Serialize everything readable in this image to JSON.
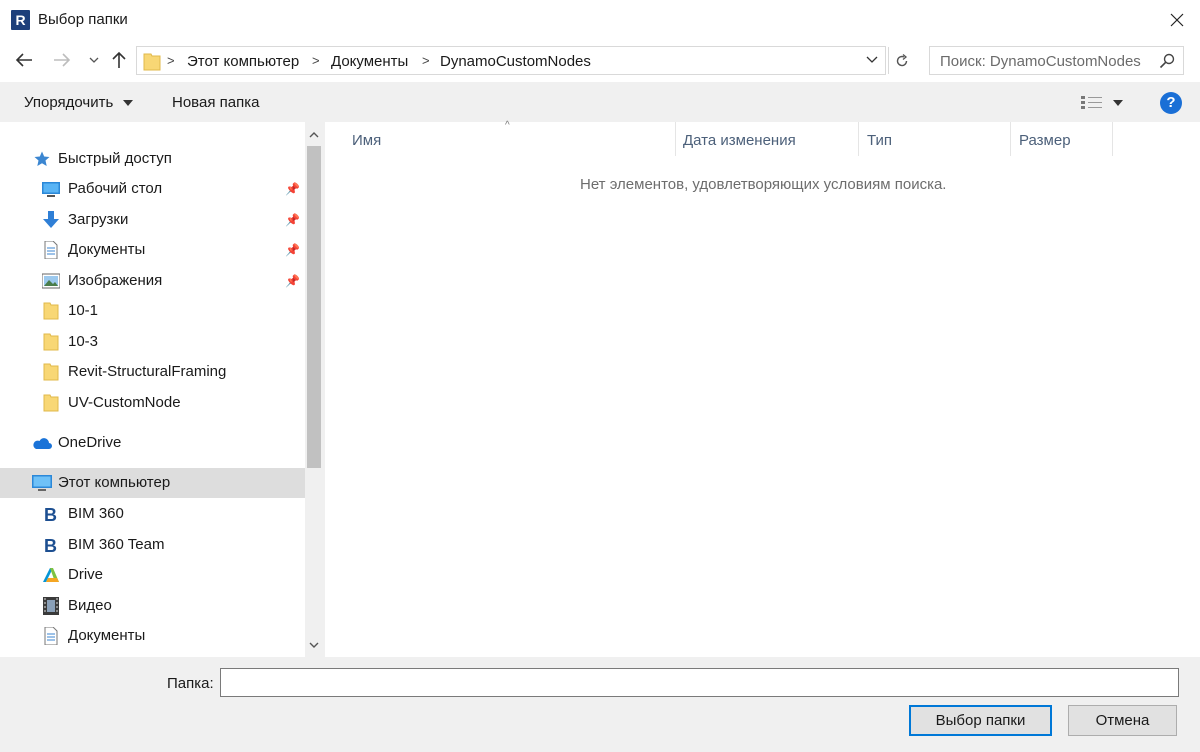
{
  "window": {
    "title": "Выбор папки",
    "app_icon_letter": "R"
  },
  "address": {
    "crumbs": [
      "Этот компьютер",
      "Документы",
      "DynamoCustomNodes"
    ],
    "search_placeholder": "Поиск: DynamoCustomNodes"
  },
  "toolbar": {
    "organize": "Упорядочить",
    "new_folder": "Новая папка",
    "help": "?"
  },
  "sidebar": {
    "quick_access": "Быстрый доступ",
    "quick_items": [
      {
        "label": "Рабочий стол",
        "icon": "desktop-icon",
        "pinned": true
      },
      {
        "label": "Загрузки",
        "icon": "download-icon",
        "pinned": true
      },
      {
        "label": "Документы",
        "icon": "document-icon",
        "pinned": true
      },
      {
        "label": "Изображения",
        "icon": "pictures-icon",
        "pinned": true
      },
      {
        "label": "10-1",
        "icon": "folder-icon",
        "pinned": false
      },
      {
        "label": "10-3",
        "icon": "folder-icon",
        "pinned": false
      },
      {
        "label": "Revit-StructuralFraming",
        "icon": "folder-icon",
        "pinned": false
      },
      {
        "label": "UV-CustomNode",
        "icon": "folder-icon",
        "pinned": false
      }
    ],
    "onedrive": "OneDrive",
    "this_pc": "Этот компьютер",
    "pc_items": [
      {
        "label": "BIM 360",
        "icon": "bim360-icon"
      },
      {
        "label": "BIM 360 Team",
        "icon": "bim360-icon"
      },
      {
        "label": "Drive",
        "icon": "autodesk-drive-icon"
      },
      {
        "label": "Видео",
        "icon": "video-icon"
      },
      {
        "label": "Документы",
        "icon": "document-icon"
      }
    ]
  },
  "columns": {
    "name": "Имя",
    "date": "Дата изменения",
    "type": "Тип",
    "size": "Размер"
  },
  "empty_message": "Нет элементов, удовлетворяющих условиям поиска.",
  "footer": {
    "folder_label": "Папка:",
    "folder_value": "",
    "select_button": "Выбор папки",
    "cancel_button": "Отмена"
  }
}
